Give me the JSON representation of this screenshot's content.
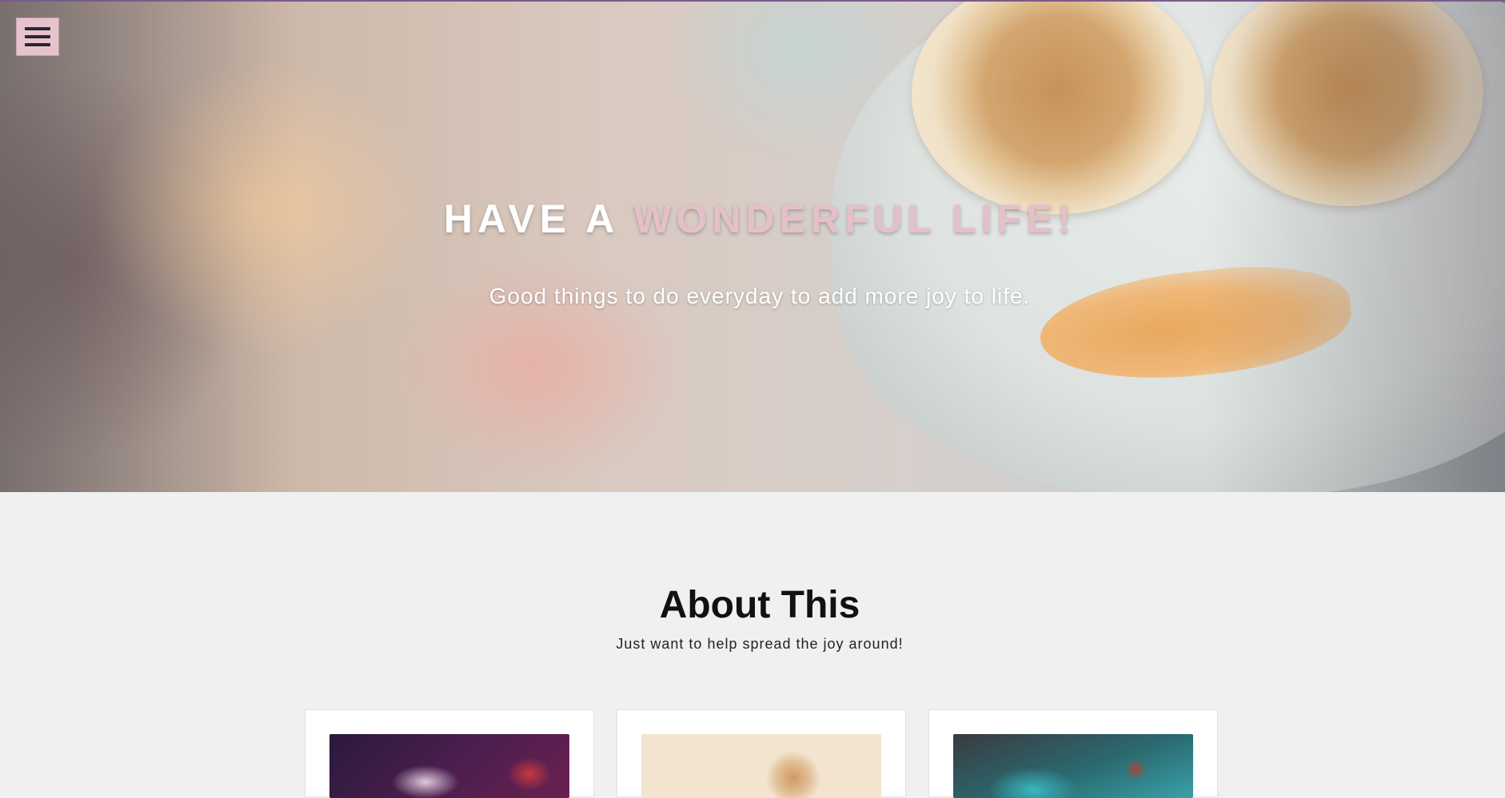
{
  "hero": {
    "title_start": "HAVE A ",
    "title_accent": "WONDERFUL LIFE!",
    "subtitle": "Good things to do everyday to add more joy to life."
  },
  "nav": {
    "menu_icon": "hamburger-menu-icon"
  },
  "about": {
    "title": "About This",
    "subtitle": "Just want to help spread the joy around!",
    "cards": [
      {
        "image": "neon-sign-photo"
      },
      {
        "image": "pancakes-photo"
      },
      {
        "image": "arcade-photo"
      }
    ]
  },
  "colors": {
    "accent": "#e4c0c8",
    "menu_background": "#e6c3cc",
    "page_background": "#f0f0f0",
    "title_text": "#ffffff"
  }
}
